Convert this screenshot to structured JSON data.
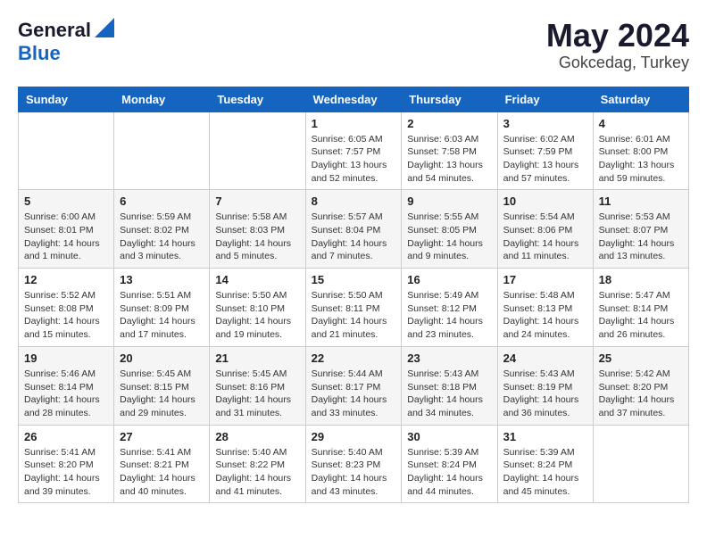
{
  "header": {
    "logo_general": "General",
    "logo_blue": "Blue",
    "month": "May 2024",
    "location": "Gokcedag, Turkey"
  },
  "weekdays": [
    "Sunday",
    "Monday",
    "Tuesday",
    "Wednesday",
    "Thursday",
    "Friday",
    "Saturday"
  ],
  "weeks": [
    [
      {
        "day": "",
        "info": ""
      },
      {
        "day": "",
        "info": ""
      },
      {
        "day": "",
        "info": ""
      },
      {
        "day": "1",
        "info": "Sunrise: 6:05 AM\nSunset: 7:57 PM\nDaylight: 13 hours\nand 52 minutes."
      },
      {
        "day": "2",
        "info": "Sunrise: 6:03 AM\nSunset: 7:58 PM\nDaylight: 13 hours\nand 54 minutes."
      },
      {
        "day": "3",
        "info": "Sunrise: 6:02 AM\nSunset: 7:59 PM\nDaylight: 13 hours\nand 57 minutes."
      },
      {
        "day": "4",
        "info": "Sunrise: 6:01 AM\nSunset: 8:00 PM\nDaylight: 13 hours\nand 59 minutes."
      }
    ],
    [
      {
        "day": "5",
        "info": "Sunrise: 6:00 AM\nSunset: 8:01 PM\nDaylight: 14 hours\nand 1 minute."
      },
      {
        "day": "6",
        "info": "Sunrise: 5:59 AM\nSunset: 8:02 PM\nDaylight: 14 hours\nand 3 minutes."
      },
      {
        "day": "7",
        "info": "Sunrise: 5:58 AM\nSunset: 8:03 PM\nDaylight: 14 hours\nand 5 minutes."
      },
      {
        "day": "8",
        "info": "Sunrise: 5:57 AM\nSunset: 8:04 PM\nDaylight: 14 hours\nand 7 minutes."
      },
      {
        "day": "9",
        "info": "Sunrise: 5:55 AM\nSunset: 8:05 PM\nDaylight: 14 hours\nand 9 minutes."
      },
      {
        "day": "10",
        "info": "Sunrise: 5:54 AM\nSunset: 8:06 PM\nDaylight: 14 hours\nand 11 minutes."
      },
      {
        "day": "11",
        "info": "Sunrise: 5:53 AM\nSunset: 8:07 PM\nDaylight: 14 hours\nand 13 minutes."
      }
    ],
    [
      {
        "day": "12",
        "info": "Sunrise: 5:52 AM\nSunset: 8:08 PM\nDaylight: 14 hours\nand 15 minutes."
      },
      {
        "day": "13",
        "info": "Sunrise: 5:51 AM\nSunset: 8:09 PM\nDaylight: 14 hours\nand 17 minutes."
      },
      {
        "day": "14",
        "info": "Sunrise: 5:50 AM\nSunset: 8:10 PM\nDaylight: 14 hours\nand 19 minutes."
      },
      {
        "day": "15",
        "info": "Sunrise: 5:50 AM\nSunset: 8:11 PM\nDaylight: 14 hours\nand 21 minutes."
      },
      {
        "day": "16",
        "info": "Sunrise: 5:49 AM\nSunset: 8:12 PM\nDaylight: 14 hours\nand 23 minutes."
      },
      {
        "day": "17",
        "info": "Sunrise: 5:48 AM\nSunset: 8:13 PM\nDaylight: 14 hours\nand 24 minutes."
      },
      {
        "day": "18",
        "info": "Sunrise: 5:47 AM\nSunset: 8:14 PM\nDaylight: 14 hours\nand 26 minutes."
      }
    ],
    [
      {
        "day": "19",
        "info": "Sunrise: 5:46 AM\nSunset: 8:14 PM\nDaylight: 14 hours\nand 28 minutes."
      },
      {
        "day": "20",
        "info": "Sunrise: 5:45 AM\nSunset: 8:15 PM\nDaylight: 14 hours\nand 29 minutes."
      },
      {
        "day": "21",
        "info": "Sunrise: 5:45 AM\nSunset: 8:16 PM\nDaylight: 14 hours\nand 31 minutes."
      },
      {
        "day": "22",
        "info": "Sunrise: 5:44 AM\nSunset: 8:17 PM\nDaylight: 14 hours\nand 33 minutes."
      },
      {
        "day": "23",
        "info": "Sunrise: 5:43 AM\nSunset: 8:18 PM\nDaylight: 14 hours\nand 34 minutes."
      },
      {
        "day": "24",
        "info": "Sunrise: 5:43 AM\nSunset: 8:19 PM\nDaylight: 14 hours\nand 36 minutes."
      },
      {
        "day": "25",
        "info": "Sunrise: 5:42 AM\nSunset: 8:20 PM\nDaylight: 14 hours\nand 37 minutes."
      }
    ],
    [
      {
        "day": "26",
        "info": "Sunrise: 5:41 AM\nSunset: 8:20 PM\nDaylight: 14 hours\nand 39 minutes."
      },
      {
        "day": "27",
        "info": "Sunrise: 5:41 AM\nSunset: 8:21 PM\nDaylight: 14 hours\nand 40 minutes."
      },
      {
        "day": "28",
        "info": "Sunrise: 5:40 AM\nSunset: 8:22 PM\nDaylight: 14 hours\nand 41 minutes."
      },
      {
        "day": "29",
        "info": "Sunrise: 5:40 AM\nSunset: 8:23 PM\nDaylight: 14 hours\nand 43 minutes."
      },
      {
        "day": "30",
        "info": "Sunrise: 5:39 AM\nSunset: 8:24 PM\nDaylight: 14 hours\nand 44 minutes."
      },
      {
        "day": "31",
        "info": "Sunrise: 5:39 AM\nSunset: 8:24 PM\nDaylight: 14 hours\nand 45 minutes."
      },
      {
        "day": "",
        "info": ""
      }
    ]
  ]
}
